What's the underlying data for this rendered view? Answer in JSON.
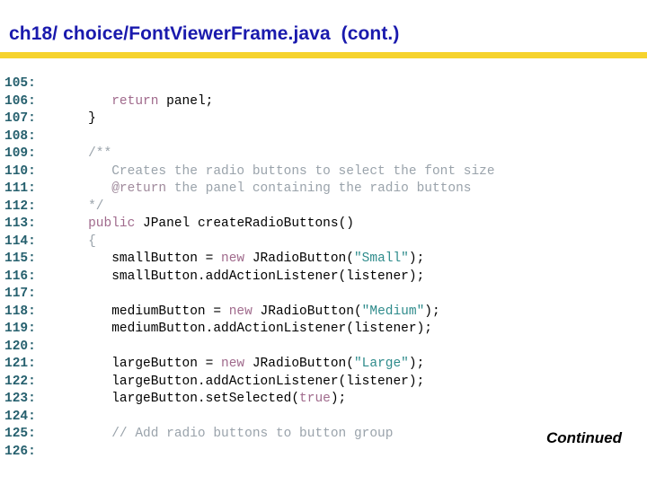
{
  "slide": {
    "title": "ch18/ choice/FontViewerFrame.java  (cont.)",
    "footer_label": "Continued",
    "accent_color": "#f6d32d",
    "title_color": "#1a1aad"
  },
  "code": {
    "line_number_color": "#26606e",
    "keyword_color": "#a06a8c",
    "string_color": "#2e8b8b",
    "comment_color": "#9aa3ab",
    "plain_color": "#000000",
    "lines": [
      {
        "number": "105:",
        "tokens": []
      },
      {
        "number": "106:",
        "tokens": [
          {
            "t": "plain",
            "v": "      "
          },
          {
            "t": "keyword",
            "v": "return"
          },
          {
            "t": "plain",
            "v": " panel;"
          }
        ]
      },
      {
        "number": "107:",
        "tokens": [
          {
            "t": "plain",
            "v": "   }"
          }
        ]
      },
      {
        "number": "108:",
        "tokens": []
      },
      {
        "number": "109:",
        "tokens": [
          {
            "t": "comment",
            "v": "   /**"
          }
        ]
      },
      {
        "number": "110:",
        "tokens": [
          {
            "t": "comment",
            "v": "      Creates the radio buttons to select the font size"
          }
        ]
      },
      {
        "number": "111:",
        "tokens": [
          {
            "t": "plain",
            "v": "      "
          },
          {
            "t": "tag",
            "v": "@return"
          },
          {
            "t": "comment",
            "v": " the panel containing the radio buttons"
          }
        ]
      },
      {
        "number": "112:",
        "tokens": [
          {
            "t": "comment",
            "v": "   */"
          }
        ]
      },
      {
        "number": "113:",
        "tokens": [
          {
            "t": "plain",
            "v": "   "
          },
          {
            "t": "keyword",
            "v": "public"
          },
          {
            "t": "plain",
            "v": " JPanel createRadioButtons()"
          }
        ]
      },
      {
        "number": "114:",
        "tokens": [
          {
            "t": "comment",
            "v": "   {"
          }
        ]
      },
      {
        "number": "115:",
        "tokens": [
          {
            "t": "plain",
            "v": "      smallButton = "
          },
          {
            "t": "keyword",
            "v": "new"
          },
          {
            "t": "plain",
            "v": " JRadioButton("
          },
          {
            "t": "string",
            "v": "\"Small\""
          },
          {
            "t": "plain",
            "v": ");"
          }
        ]
      },
      {
        "number": "116:",
        "tokens": [
          {
            "t": "plain",
            "v": "      smallButton.addActionListener(listener);"
          }
        ]
      },
      {
        "number": "117:",
        "tokens": []
      },
      {
        "number": "118:",
        "tokens": [
          {
            "t": "plain",
            "v": "      mediumButton = "
          },
          {
            "t": "keyword",
            "v": "new"
          },
          {
            "t": "plain",
            "v": " JRadioButton("
          },
          {
            "t": "string",
            "v": "\"Medium\""
          },
          {
            "t": "plain",
            "v": ");"
          }
        ]
      },
      {
        "number": "119:",
        "tokens": [
          {
            "t": "plain",
            "v": "      mediumButton.addActionListener(listener);"
          }
        ]
      },
      {
        "number": "120:",
        "tokens": []
      },
      {
        "number": "121:",
        "tokens": [
          {
            "t": "plain",
            "v": "      largeButton = "
          },
          {
            "t": "keyword",
            "v": "new"
          },
          {
            "t": "plain",
            "v": " JRadioButton("
          },
          {
            "t": "string",
            "v": "\"Large\""
          },
          {
            "t": "plain",
            "v": ");"
          }
        ]
      },
      {
        "number": "122:",
        "tokens": [
          {
            "t": "plain",
            "v": "      largeButton.addActionListener(listener);"
          }
        ]
      },
      {
        "number": "123:",
        "tokens": [
          {
            "t": "plain",
            "v": "      largeButton.setSelected("
          },
          {
            "t": "keyword",
            "v": "true"
          },
          {
            "t": "plain",
            "v": ");"
          }
        ]
      },
      {
        "number": "124:",
        "tokens": []
      },
      {
        "number": "125:",
        "tokens": [
          {
            "t": "comment",
            "v": "      // Add radio buttons to button group"
          }
        ]
      },
      {
        "number": "126:",
        "tokens": []
      }
    ]
  }
}
